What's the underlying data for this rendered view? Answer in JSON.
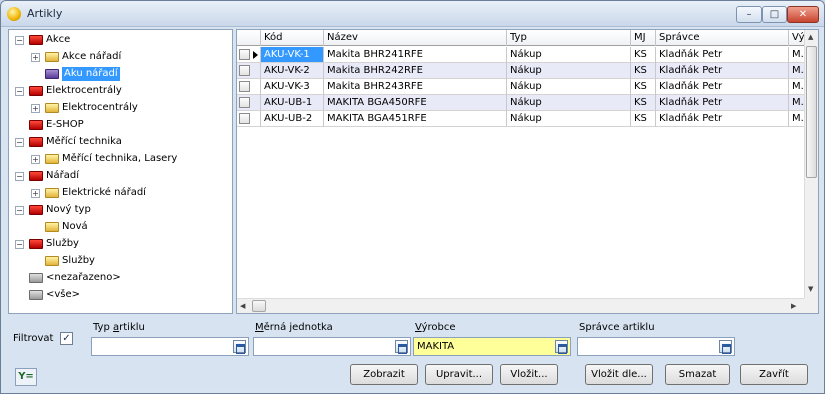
{
  "window": {
    "title": "Artikly",
    "min_label": "–",
    "max_label": "□",
    "close_label": "✕"
  },
  "tree": [
    {
      "label": "Akce",
      "level": 0,
      "expander": "−",
      "folder": "red"
    },
    {
      "label": "Akce nářadí",
      "level": 1,
      "expander": "+",
      "folder": "yel"
    },
    {
      "label": "Aku nářadí",
      "level": 1,
      "expander": "",
      "folder": "purple",
      "selected": true
    },
    {
      "label": "Elektrocentrály",
      "level": 0,
      "expander": "−",
      "folder": "red"
    },
    {
      "label": "Elektrocentrály",
      "level": 1,
      "expander": "+",
      "folder": "yel"
    },
    {
      "label": "E-SHOP",
      "level": 0,
      "expander": "",
      "folder": "red"
    },
    {
      "label": "Měřící technika",
      "level": 0,
      "expander": "−",
      "folder": "red"
    },
    {
      "label": "Měřící technika, Lasery",
      "level": 1,
      "expander": "+",
      "folder": "yel"
    },
    {
      "label": "Nářadí",
      "level": 0,
      "expander": "−",
      "folder": "red"
    },
    {
      "label": "Elektrické nářadí",
      "level": 1,
      "expander": "+",
      "folder": "yel"
    },
    {
      "label": "Nový typ",
      "level": 0,
      "expander": "−",
      "folder": "red"
    },
    {
      "label": "Nová",
      "level": 1,
      "expander": "",
      "folder": "yel"
    },
    {
      "label": "Služby",
      "level": 0,
      "expander": "−",
      "folder": "red"
    },
    {
      "label": "Služby",
      "level": 1,
      "expander": "",
      "folder": "yel"
    },
    {
      "label": "<nezařazeno>",
      "level": 0,
      "expander": "",
      "folder": "gray"
    },
    {
      "label": "<vše>",
      "level": 0,
      "expander": "",
      "folder": "gray"
    }
  ],
  "table": {
    "columns": [
      "Kód",
      "Název",
      "Typ",
      "MJ",
      "Správce",
      "Vý"
    ],
    "rows": [
      [
        "AKU-VK-1",
        "Makita BHR241RFE",
        "Nákup",
        "KS",
        "Kladňák Petr",
        "M."
      ],
      [
        "AKU-VK-2",
        "Makita BHR242RFE",
        "Nákup",
        "KS",
        "Kladňák Petr",
        "M."
      ],
      [
        "AKU-VK-3",
        "Makita BHR243RFE",
        "Nákup",
        "KS",
        "Kladňák Petr",
        "M."
      ],
      [
        "AKU-UB-1",
        "MAKITA BGA450RFE",
        "Nákup",
        "KS",
        "Kladňák Petr",
        "M."
      ],
      [
        "AKU-UB-2",
        "MAKITA BGA451RFE",
        "Nákup",
        "KS",
        "Kladňák Petr",
        "M."
      ]
    ]
  },
  "filter": {
    "label": "Filtrovat",
    "checked_mark": "✓",
    "fields": [
      {
        "title_pre": "Typ ",
        "title_u": "a",
        "title_post": "rtiklu",
        "value": ""
      },
      {
        "title_pre": "",
        "title_u": "M",
        "title_post": "ěrná jednotka",
        "value": ""
      },
      {
        "title_pre": "",
        "title_u": "V",
        "title_post": "ýrobce",
        "value": "MAKITA"
      },
      {
        "title_pre": "Správce artiklu",
        "title_u": "",
        "title_post": "",
        "value": ""
      }
    ]
  },
  "buttons": {
    "funnel": "Y=",
    "show": "Zobrazit",
    "edit": "Upravit...",
    "insert": "Vložit...",
    "insert_by": "Vložit dle...",
    "delete": "Smazat",
    "close": "Zavřít"
  }
}
